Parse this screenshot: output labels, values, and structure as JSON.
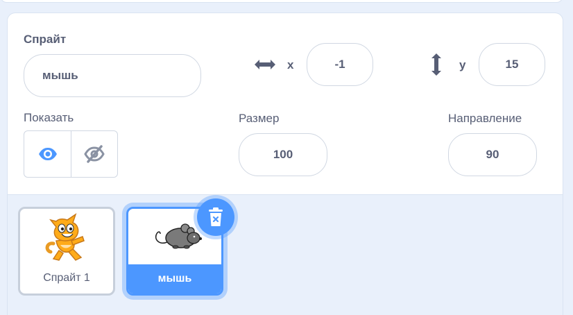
{
  "sprite_info": {
    "sprite_label": "Спрайт",
    "sprite_name": "мышь",
    "x_label": "x",
    "x_value": "-1",
    "y_label": "y",
    "y_value": "15",
    "show_label": "Показать",
    "size_label": "Размер",
    "size_value": "100",
    "direction_label": "Направление",
    "direction_value": "90",
    "visible_selected": "show"
  },
  "sprites": [
    {
      "name": "Спрайт 1",
      "selected": false,
      "icon": "scratch-cat-costume"
    },
    {
      "name": "мышь",
      "selected": true,
      "icon": "mouse-costume"
    }
  ],
  "colors": {
    "accent": "#4c97ff",
    "text": "#575e75",
    "panel_bg": "#e9f0fb",
    "border": "#d0d7e2"
  },
  "icons": {
    "x_icon": "horizontal-arrows-icon",
    "y_icon": "vertical-arrows-icon",
    "show_icon": "eye-icon",
    "hide_icon": "eye-slash-icon",
    "delete_icon": "trash-icon"
  }
}
